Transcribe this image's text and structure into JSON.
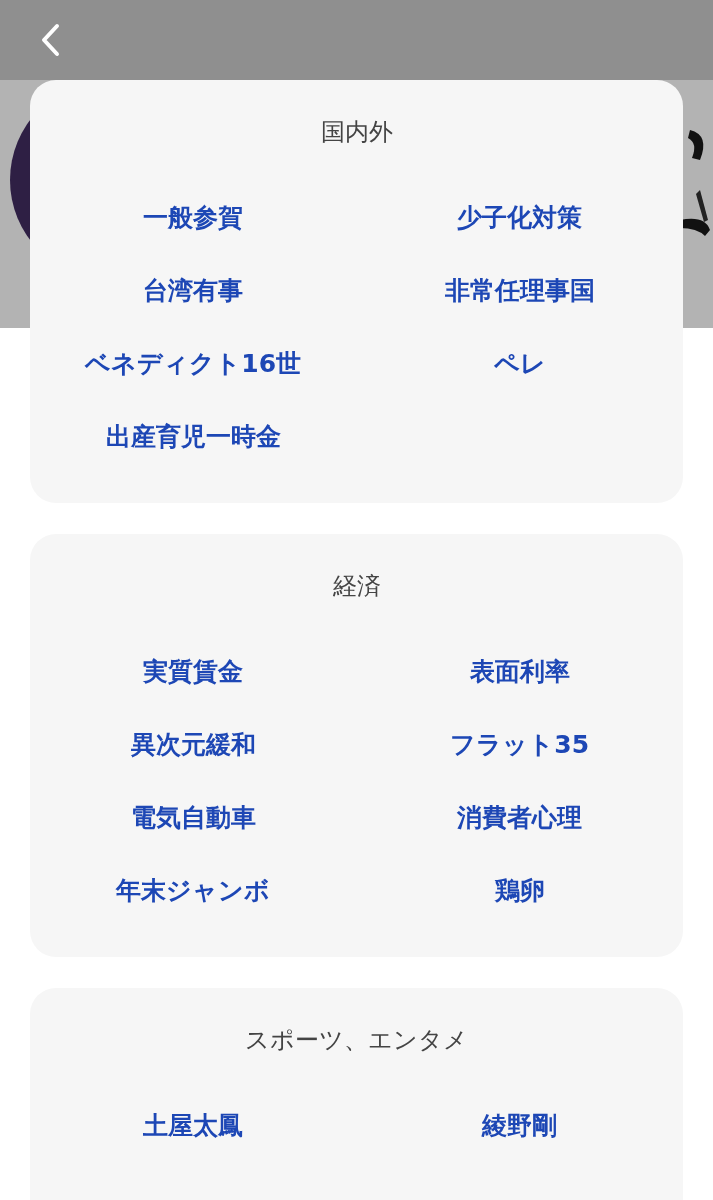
{
  "sections": [
    {
      "title": "国内外",
      "items": [
        "一般参賀",
        "少子化対策",
        "台湾有事",
        "非常任理事国",
        "ベネディクト16世",
        "ペレ",
        "出産育児一時金"
      ]
    },
    {
      "title": "経済",
      "items": [
        "実質賃金",
        "表面利率",
        "異次元緩和",
        "フラット35",
        "電気自動車",
        "消費者心理",
        "年末ジャンボ",
        "鶏卵"
      ]
    },
    {
      "title": "スポーツ、エンタメ",
      "items": [
        "土屋太鳳",
        "綾野剛"
      ]
    }
  ]
}
